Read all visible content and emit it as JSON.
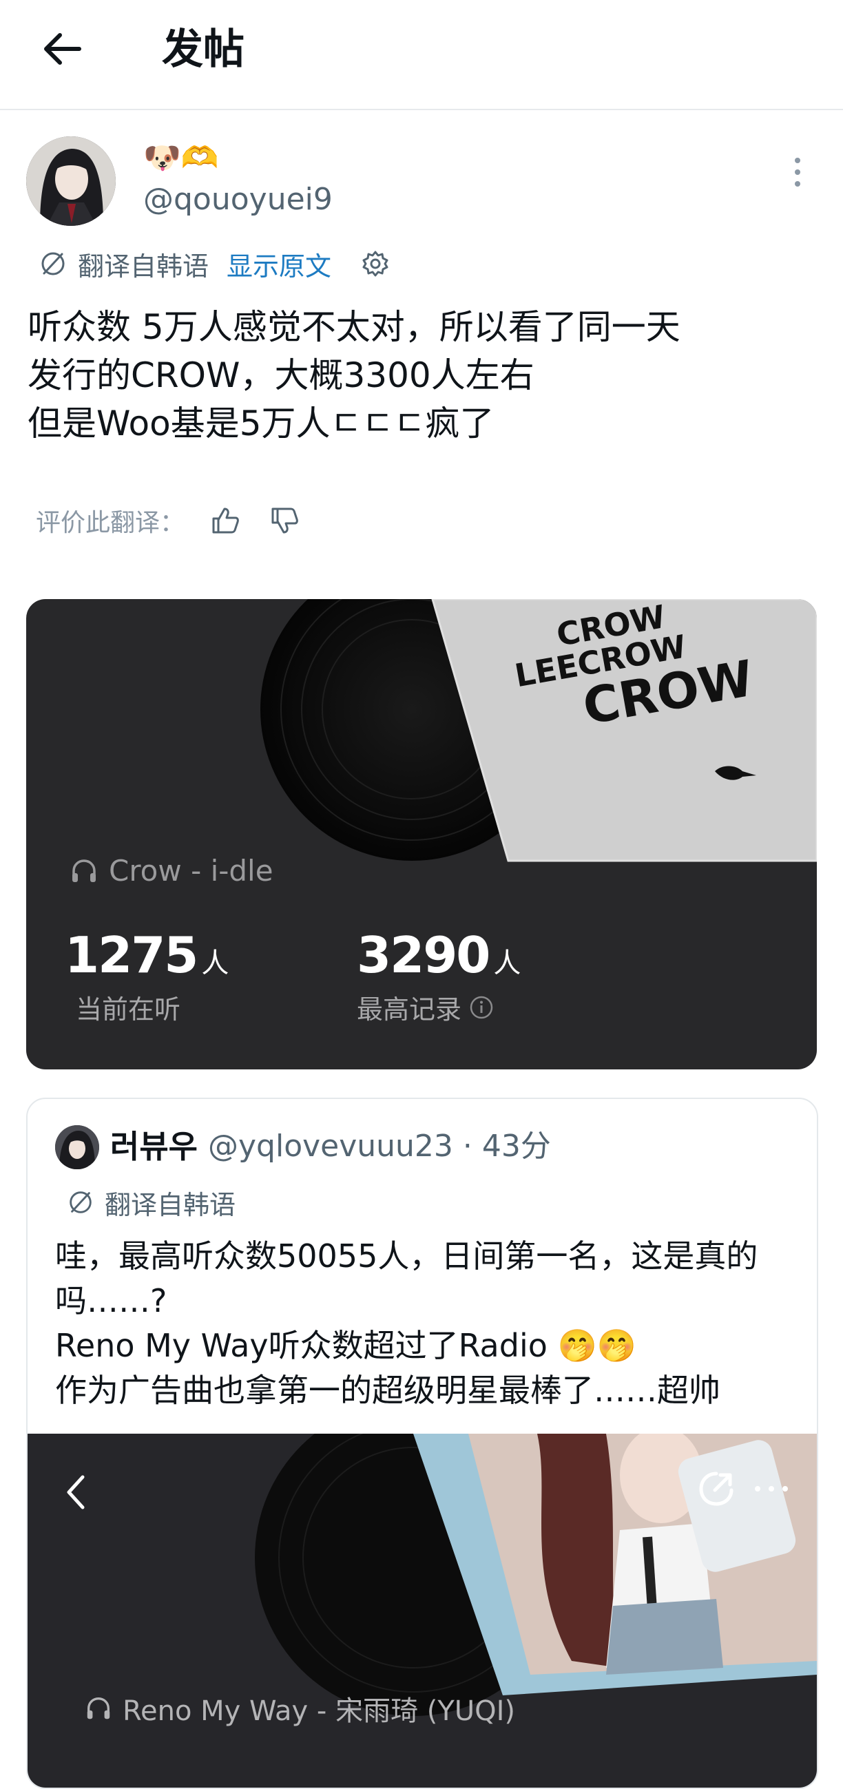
{
  "header": {
    "title": "发帖"
  },
  "post": {
    "user_emoji": "🐶🫶",
    "handle": "@qouoyuei9",
    "translate_label": "翻译自韩语",
    "show_original": "显示原文",
    "lines": [
      "听众数 5万人感觉不太对，所以看了同一天",
      "发行的CROW，大概3300人左右",
      "但是Woo基是5万人ㄷㄷㄷ疯了"
    ],
    "rate_label": "评价此翻译："
  },
  "music_card": {
    "song": "Crow - i-dle",
    "current_value": "1275",
    "current_unit": "人",
    "current_caption": "当前在听",
    "peak_value": "3290",
    "peak_unit": "人",
    "peak_caption": "最高记录",
    "cover_words": [
      "CROW",
      "LEECROW",
      "CROW"
    ]
  },
  "quote": {
    "name": "러뷰우",
    "handle_time": "@yqlovevuuu23 · 43分",
    "translate_label": "翻译自韩语",
    "lines": [
      "哇，最高听众数50055人，日间第一名，这是真的",
      "吗……?",
      "Reno My Way听众数超过了Radio 🤭🤭",
      "作为广告曲也拿第一的超级明星最棒了……超帅"
    ],
    "song": "Reno My Way - 宋雨琦 (YUQI)"
  },
  "colors": {
    "link": "#1d7bc2",
    "secondary": "#536471",
    "card_bg": "#28282a"
  }
}
